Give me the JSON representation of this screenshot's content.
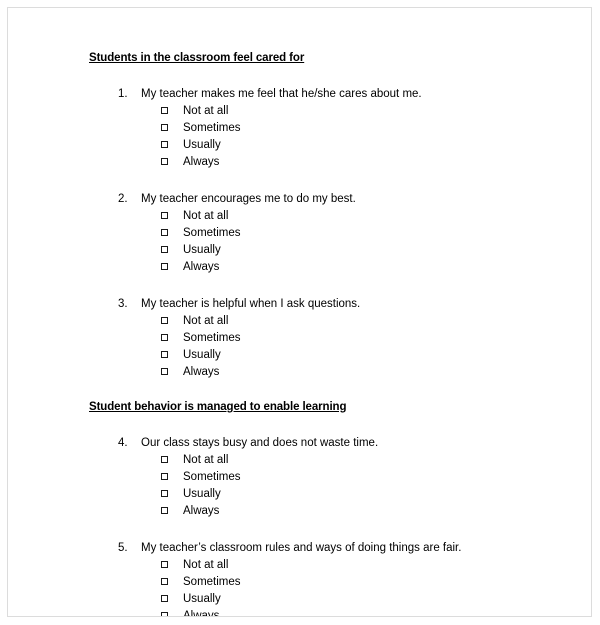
{
  "document": {
    "options_template": [
      "Not at all",
      "Sometimes",
      "Usually",
      "Always"
    ],
    "sections": [
      {
        "heading": "Students in the classroom feel cared for",
        "questions": [
          {
            "number": "1.",
            "text": "My teacher makes me feel that he/she cares about me.",
            "options": [
              "Not at all",
              "Sometimes",
              "Usually",
              "Always"
            ]
          },
          {
            "number": "2.",
            "text": "My teacher encourages me to do my best.",
            "options": [
              "Not at all",
              "Sometimes",
              "Usually",
              "Always"
            ]
          },
          {
            "number": "3.",
            "text": "My teacher is helpful when I ask questions.",
            "options": [
              "Not at all",
              "Sometimes",
              "Usually",
              "Always"
            ]
          }
        ]
      },
      {
        "heading": "Student behavior is managed to enable learning",
        "questions": [
          {
            "number": "4.",
            "text": "Our class stays busy and does not waste time.",
            "options": [
              "Not at all",
              "Sometimes",
              "Usually",
              "Always"
            ]
          },
          {
            "number": "5.",
            "text": "My teacher’s classroom rules and ways of doing things are fair.",
            "options": [
              "Not at all",
              "Sometimes",
              "Usually",
              "Always"
            ]
          }
        ]
      }
    ]
  },
  "colors": {
    "text": "#000000",
    "page_background": "#ffffff",
    "page_border": "#dcdcdc",
    "checkbox_border": "#1a1a1a"
  }
}
